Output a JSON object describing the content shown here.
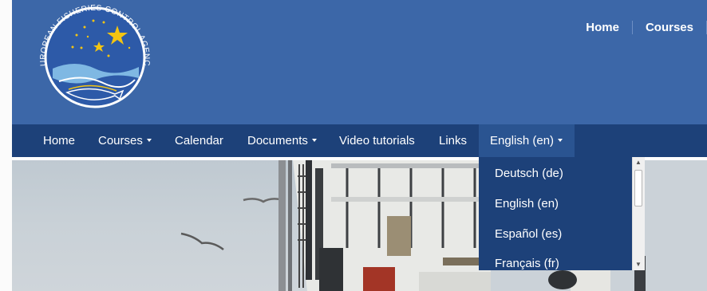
{
  "logo": {
    "agency_name": "EUROPEAN FISHERIES CONTROL AGENCY",
    "colors": {
      "circle": "#2d5aa8",
      "stars": "#f4c512",
      "waves": "#7fb8e3"
    }
  },
  "top_nav": {
    "home": "Home",
    "courses": "Courses"
  },
  "main_nav": {
    "home": "Home",
    "courses": "Courses",
    "calendar": "Calendar",
    "documents": "Documents",
    "video_tutorials": "Video tutorials",
    "links": "Links",
    "language": "English (en)"
  },
  "language_menu": {
    "options": [
      "Deutsch (de)",
      "English (en)",
      "Español (es)",
      "Français (fr)"
    ]
  },
  "colors": {
    "header_bg": "#3c67a8",
    "navbar_bg": "#1d4179",
    "active_bg": "#2a5491"
  }
}
